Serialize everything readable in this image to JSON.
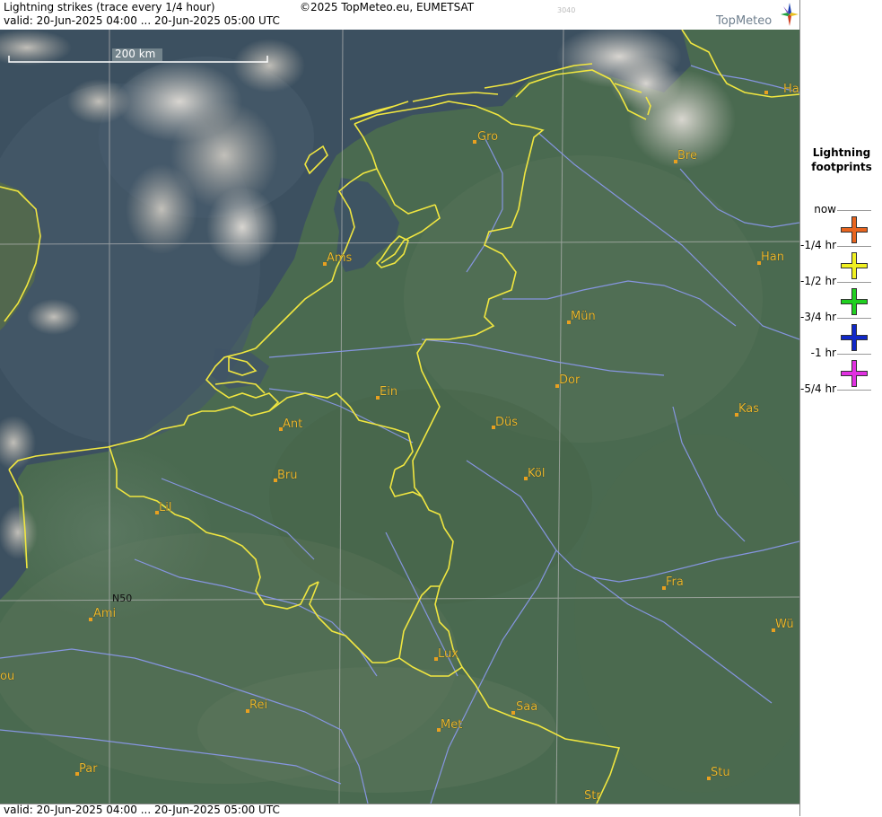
{
  "header": {
    "title": "Lightning strikes (trace every 1/4 hour)",
    "copyright": "©2025 TopMeteo.eu, EUMETSAT",
    "code": "3040",
    "valid": "valid:  20-Jun-2025 04:00 ... 20-Jun-2025 05:00 UTC"
  },
  "logo": {
    "text": "TopMeteo"
  },
  "footer": {
    "valid": "valid:  20-Jun-2025 04:00 ... 20-Jun-2025 05:00 UTC"
  },
  "map": {
    "scale_label": "200 km",
    "grid_label": "N50",
    "colors": {
      "border": "#f0e640",
      "river": "#8c9af0",
      "city": "#e8a020",
      "grid": "#b8b8b8"
    },
    "cities": {
      "hamburg": "Ha",
      "bremen": "Bre",
      "groningen": "Gro",
      "amsterdam": "Ams",
      "hannover": "Han",
      "muenster": "Mün",
      "dortmund": "Dor",
      "eindhoven": "Ein",
      "antwerp": "Ant",
      "duesseldorf": "Düs",
      "kassel": "Kas",
      "brussels": "Bru",
      "koeln": "Köl",
      "lille": "Lil",
      "frankfurt": "Fra",
      "wuerzburg": "Wü",
      "amiens": "Ami",
      "luxembourg": "Lux",
      "rouen": "ou",
      "reims": "Rei",
      "saarbruecken": "Saa",
      "metz": "Met",
      "paris": "Par",
      "stuttgart": "Stu",
      "strasbourg": "Str"
    }
  },
  "legend": {
    "title_line1": "Lightning",
    "title_line2": "footprints",
    "rows": [
      {
        "label": "now",
        "color": "#e8641e"
      },
      {
        "label": "-1/4 hr",
        "color": "#f0f020"
      },
      {
        "label": "-1/2 hr",
        "color": "#20d020"
      },
      {
        "label": "-3/4 hr",
        "color": "#1028c8"
      },
      {
        "label": "-1 hr",
        "color": "#e030e0"
      }
    ],
    "last_label": "-5/4 hr"
  }
}
